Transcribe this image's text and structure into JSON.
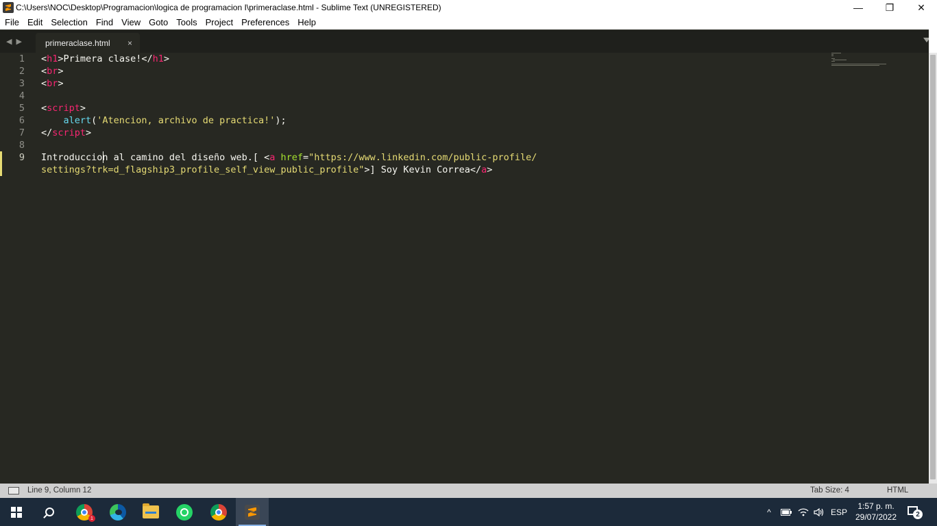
{
  "window": {
    "title": "C:\\Users\\NOC\\Desktop\\Programacion\\logica de programacion I\\primeraclase.html - Sublime Text (UNREGISTERED)",
    "controls": {
      "minimize": "—",
      "maximize": "❐",
      "close": "✕"
    }
  },
  "menu": [
    "File",
    "Edit",
    "Selection",
    "Find",
    "View",
    "Goto",
    "Tools",
    "Project",
    "Preferences",
    "Help"
  ],
  "tabs": {
    "nav_back": "◀",
    "nav_forward": "▶",
    "active": {
      "label": "primeraclase.html",
      "close": "×"
    }
  },
  "editor": {
    "line_numbers": [
      "1",
      "2",
      "3",
      "4",
      "5",
      "6",
      "7",
      "8",
      "9"
    ],
    "active_line": 9,
    "code": {
      "l1": {
        "open": "<",
        "tag": "h1",
        "gt": ">",
        "text": "Primera clase!",
        "close_open": "</",
        "close_tag": "h1",
        "close_gt": ">"
      },
      "l2": {
        "open": "<",
        "tag": "br",
        "gt": ">"
      },
      "l3": {
        "open": "<",
        "tag": "br",
        "gt": ">"
      },
      "l5": {
        "open": "<",
        "tag": "script",
        "gt": ">"
      },
      "l6": {
        "indent": "    ",
        "fn": "alert",
        "paren_open": "(",
        "str": "'Atencion, archivo de practica!'",
        "paren_close": ");"
      },
      "l7": {
        "open": "</",
        "tag": "script",
        "gt": ">"
      },
      "l9a": {
        "text": "Introduccion al camino del diseño web.[ ",
        "open": "<",
        "tag": "a",
        "attr": " href",
        "eq": "=",
        "str": "\"https://www.linkedin.com/public-profile/"
      },
      "l9b": {
        "str": "settings?trk=d_flagship3_profile_self_view_public_profile\"",
        "gt": ">",
        "text": "] Soy Kevin Correa",
        "close_open": "</",
        "close_tag": "a",
        "close_gt": ">"
      }
    }
  },
  "status": {
    "position": "Line 9, Column 12",
    "tab_size": "Tab Size: 4",
    "syntax": "HTML"
  },
  "taskbar": {
    "apps": [
      "windows-start",
      "search",
      "chrome",
      "edge",
      "file-explorer",
      "whatsapp",
      "chrome-profile",
      "sublime-text"
    ],
    "chrome_badge": "1",
    "tray": {
      "chevron": "^",
      "language": "ESP"
    },
    "clock": {
      "time": "1:57 p. m.",
      "date": "29/07/2022"
    },
    "notification_count": "2"
  }
}
